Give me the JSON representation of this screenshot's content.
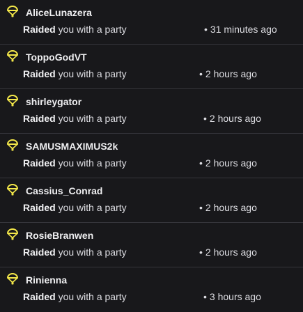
{
  "feed": {
    "items": [
      {
        "name": "AliceLunazera",
        "action": "Raided",
        "rest": " you with a party",
        "time": "31 minutes ago"
      },
      {
        "name": "ToppoGodVT",
        "action": "Raided",
        "rest": " you with a party",
        "time": "2 hours ago"
      },
      {
        "name": "shirleygator",
        "action": "Raided",
        "rest": " you with a party",
        "time": "2 hours ago"
      },
      {
        "name": "SAMUSMAXIMUS2k",
        "action": "Raided",
        "rest": " you with a party",
        "time": "2 hours ago"
      },
      {
        "name": "Cassius_Conrad",
        "action": "Raided",
        "rest": " you with a party",
        "time": "2 hours ago"
      },
      {
        "name": "RosieBranwen",
        "action": "Raided",
        "rest": " you with a party",
        "time": "2 hours ago"
      },
      {
        "name": "Rinienna",
        "action": "Raided",
        "rest": " you with a party",
        "time": "3 hours ago"
      }
    ],
    "icon": "raid-parachute-icon",
    "accent_color": "#f5e94a",
    "separator": "•"
  }
}
